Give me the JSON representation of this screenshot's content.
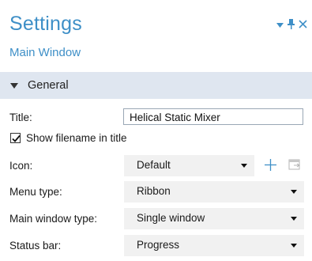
{
  "header": {
    "title": "Settings",
    "subtitle": "Main Window"
  },
  "window_controls": {
    "menu_icon": "triangle-down-icon",
    "pin_icon": "pin-icon",
    "close_icon": "close-icon"
  },
  "section": {
    "label": "General",
    "expanded": true
  },
  "fields": {
    "title_label": "Title:",
    "title_value": "Helical Static Mixer",
    "show_filename_label": "Show filename in title",
    "show_filename_checked": true,
    "icon_label": "Icon:",
    "icon_value": "Default",
    "menu_type_label": "Menu type:",
    "menu_type_value": "Ribbon",
    "main_window_type_label": "Main window type:",
    "main_window_type_value": "Single window",
    "status_bar_label": "Status bar:",
    "status_bar_value": "Progress"
  },
  "colors": {
    "accent": "#3e8fc7",
    "section_bg": "#dfe6f0",
    "select_bg": "#f1f1f1"
  }
}
